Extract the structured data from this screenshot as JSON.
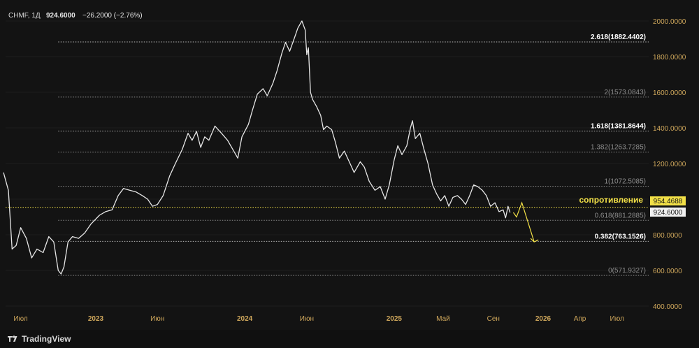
{
  "header": {
    "symbol": "CHMF, 1Д",
    "last": "924.6000",
    "change": "−26.2000 (−2.76%)"
  },
  "branding": {
    "text": "TradingView",
    "logo_icon": "tradingview-logo-icon"
  },
  "colors": {
    "background": "#131313",
    "price_line": "#e6e6e6",
    "axis_text": "#d0a85c",
    "annotation": "#f2e047",
    "level_line": "#8a8a8a"
  },
  "annotations": {
    "resistance_label": "сопротивление",
    "resistance_price": "954.4688",
    "last_price": "924.6000"
  },
  "chart_data": {
    "type": "line",
    "title": "",
    "ylim": [
      400,
      2000
    ],
    "y_ticks": [
      "2000.0000",
      "1800.0000",
      "1600.0000",
      "1400.0000",
      "1200.0000",
      "1000.0000",
      "800.0000",
      "600.0000",
      "400.0000"
    ],
    "x_ticks": [
      {
        "label": "Июл",
        "date": "2022-07-01"
      },
      {
        "label": "2023",
        "date": "2023-01-01"
      },
      {
        "label": "Июн",
        "date": "2023-06-01"
      },
      {
        "label": "2024",
        "date": "2024-01-01"
      },
      {
        "label": "Июн",
        "date": "2024-06-01"
      },
      {
        "label": "2025",
        "date": "2025-01-01"
      },
      {
        "label": "Май",
        "date": "2025-05-01"
      },
      {
        "label": "Сен",
        "date": "2025-09-01"
      },
      {
        "label": "2026",
        "date": "2026-01-01"
      },
      {
        "label": "Апр",
        "date": "2026-04-01"
      },
      {
        "label": "Июл",
        "date": "2026-07-01"
      }
    ],
    "fib_levels": [
      {
        "label": "2.618(1882.4402)",
        "value": 1882.4402,
        "bold": true
      },
      {
        "label": "2(1573.0843)",
        "value": 1573.0843,
        "bold": false
      },
      {
        "label": "1.618(1381.8644)",
        "value": 1381.8644,
        "bold": true
      },
      {
        "label": "1.382(1263.7285)",
        "value": 1263.7285,
        "bold": false
      },
      {
        "label": "1(1072.5085)",
        "value": 1072.5085,
        "bold": false
      },
      {
        "label": "0.618(881.2885)",
        "value": 881.2885,
        "bold": false
      },
      {
        "label": "0.382(763.1526)",
        "value": 763.1526,
        "bold": true
      },
      {
        "label": "0(571.9327)",
        "value": 571.9327,
        "bold": false
      }
    ],
    "resistance_level": 954.4688,
    "series": [
      {
        "values": [
          [
            "2022-05-20",
            1150
          ],
          [
            "2022-06-01",
            1050
          ],
          [
            "2022-06-10",
            720
          ],
          [
            "2022-06-20",
            740
          ],
          [
            "2022-07-01",
            840
          ],
          [
            "2022-07-15",
            780
          ],
          [
            "2022-07-28",
            670
          ],
          [
            "2022-08-10",
            720
          ],
          [
            "2022-08-25",
            700
          ],
          [
            "2022-09-08",
            790
          ],
          [
            "2022-09-20",
            760
          ],
          [
            "2022-10-01",
            600
          ],
          [
            "2022-10-08",
            580
          ],
          [
            "2022-10-15",
            620
          ],
          [
            "2022-10-25",
            760
          ],
          [
            "2022-11-05",
            790
          ],
          [
            "2022-11-20",
            780
          ],
          [
            "2022-12-05",
            810
          ],
          [
            "2022-12-20",
            860
          ],
          [
            "2023-01-10",
            910
          ],
          [
            "2023-01-25",
            930
          ],
          [
            "2023-02-10",
            940
          ],
          [
            "2023-02-25",
            1020
          ],
          [
            "2023-03-10",
            1060
          ],
          [
            "2023-03-25",
            1050
          ],
          [
            "2023-04-10",
            1040
          ],
          [
            "2023-04-25",
            1020
          ],
          [
            "2023-05-08",
            1000
          ],
          [
            "2023-05-20",
            960
          ],
          [
            "2023-06-01",
            970
          ],
          [
            "2023-06-15",
            1020
          ],
          [
            "2023-07-01",
            1130
          ],
          [
            "2023-07-15",
            1200
          ],
          [
            "2023-08-01",
            1280
          ],
          [
            "2023-08-15",
            1370
          ],
          [
            "2023-08-25",
            1330
          ],
          [
            "2023-09-05",
            1380
          ],
          [
            "2023-09-15",
            1290
          ],
          [
            "2023-09-25",
            1350
          ],
          [
            "2023-10-05",
            1330
          ],
          [
            "2023-10-20",
            1410
          ],
          [
            "2023-11-05",
            1370
          ],
          [
            "2023-11-20",
            1330
          ],
          [
            "2023-12-05",
            1270
          ],
          [
            "2023-12-15",
            1230
          ],
          [
            "2023-12-25",
            1350
          ],
          [
            "2024-01-10",
            1420
          ],
          [
            "2024-01-20",
            1500
          ],
          [
            "2024-02-01",
            1590
          ],
          [
            "2024-02-15",
            1620
          ],
          [
            "2024-02-25",
            1580
          ],
          [
            "2024-03-10",
            1650
          ],
          [
            "2024-03-20",
            1720
          ],
          [
            "2024-04-01",
            1820
          ],
          [
            "2024-04-10",
            1880
          ],
          [
            "2024-04-20",
            1830
          ],
          [
            "2024-05-01",
            1900
          ],
          [
            "2024-05-10",
            1960
          ],
          [
            "2024-05-20",
            2000
          ],
          [
            "2024-05-28",
            1950
          ],
          [
            "2024-06-01",
            1810
          ],
          [
            "2024-06-05",
            1850
          ],
          [
            "2024-06-10",
            1600
          ],
          [
            "2024-06-15",
            1560
          ],
          [
            "2024-06-25",
            1520
          ],
          [
            "2024-07-05",
            1470
          ],
          [
            "2024-07-12",
            1390
          ],
          [
            "2024-07-20",
            1410
          ],
          [
            "2024-08-01",
            1390
          ],
          [
            "2024-08-10",
            1320
          ],
          [
            "2024-08-20",
            1230
          ],
          [
            "2024-09-01",
            1270
          ],
          [
            "2024-09-15",
            1200
          ],
          [
            "2024-09-25",
            1150
          ],
          [
            "2024-10-10",
            1210
          ],
          [
            "2024-10-20",
            1180
          ],
          [
            "2024-11-01",
            1100
          ],
          [
            "2024-11-15",
            1050
          ],
          [
            "2024-11-28",
            1070
          ],
          [
            "2024-12-10",
            1000
          ],
          [
            "2024-12-20",
            1080
          ],
          [
            "2025-01-01",
            1220
          ],
          [
            "2025-01-10",
            1300
          ],
          [
            "2025-01-20",
            1250
          ],
          [
            "2025-02-01",
            1300
          ],
          [
            "2025-02-10",
            1400
          ],
          [
            "2025-02-15",
            1440
          ],
          [
            "2025-02-22",
            1340
          ],
          [
            "2025-03-05",
            1370
          ],
          [
            "2025-03-15",
            1280
          ],
          [
            "2025-03-25",
            1200
          ],
          [
            "2025-04-05",
            1080
          ],
          [
            "2025-04-15",
            1030
          ],
          [
            "2025-04-25",
            990
          ],
          [
            "2025-05-05",
            1020
          ],
          [
            "2025-05-15",
            960
          ],
          [
            "2025-05-25",
            1010
          ],
          [
            "2025-06-05",
            1020
          ],
          [
            "2025-06-15",
            1000
          ],
          [
            "2025-06-25",
            970
          ],
          [
            "2025-07-05",
            1020
          ],
          [
            "2025-07-15",
            1080
          ],
          [
            "2025-07-25",
            1070
          ],
          [
            "2025-08-05",
            1050
          ],
          [
            "2025-08-15",
            1020
          ],
          [
            "2025-08-25",
            960
          ],
          [
            "2025-09-05",
            980
          ],
          [
            "2025-09-15",
            930
          ],
          [
            "2025-09-25",
            940
          ],
          [
            "2025-10-01",
            895
          ],
          [
            "2025-10-07",
            960
          ],
          [
            "2025-10-12",
            924.6
          ]
        ]
      }
    ],
    "projection": [
      [
        "2025-10-20",
        925
      ],
      [
        "2025-10-28",
        900
      ],
      [
        "2025-11-10",
        980
      ],
      [
        "2025-12-10",
        760
      ]
    ]
  }
}
